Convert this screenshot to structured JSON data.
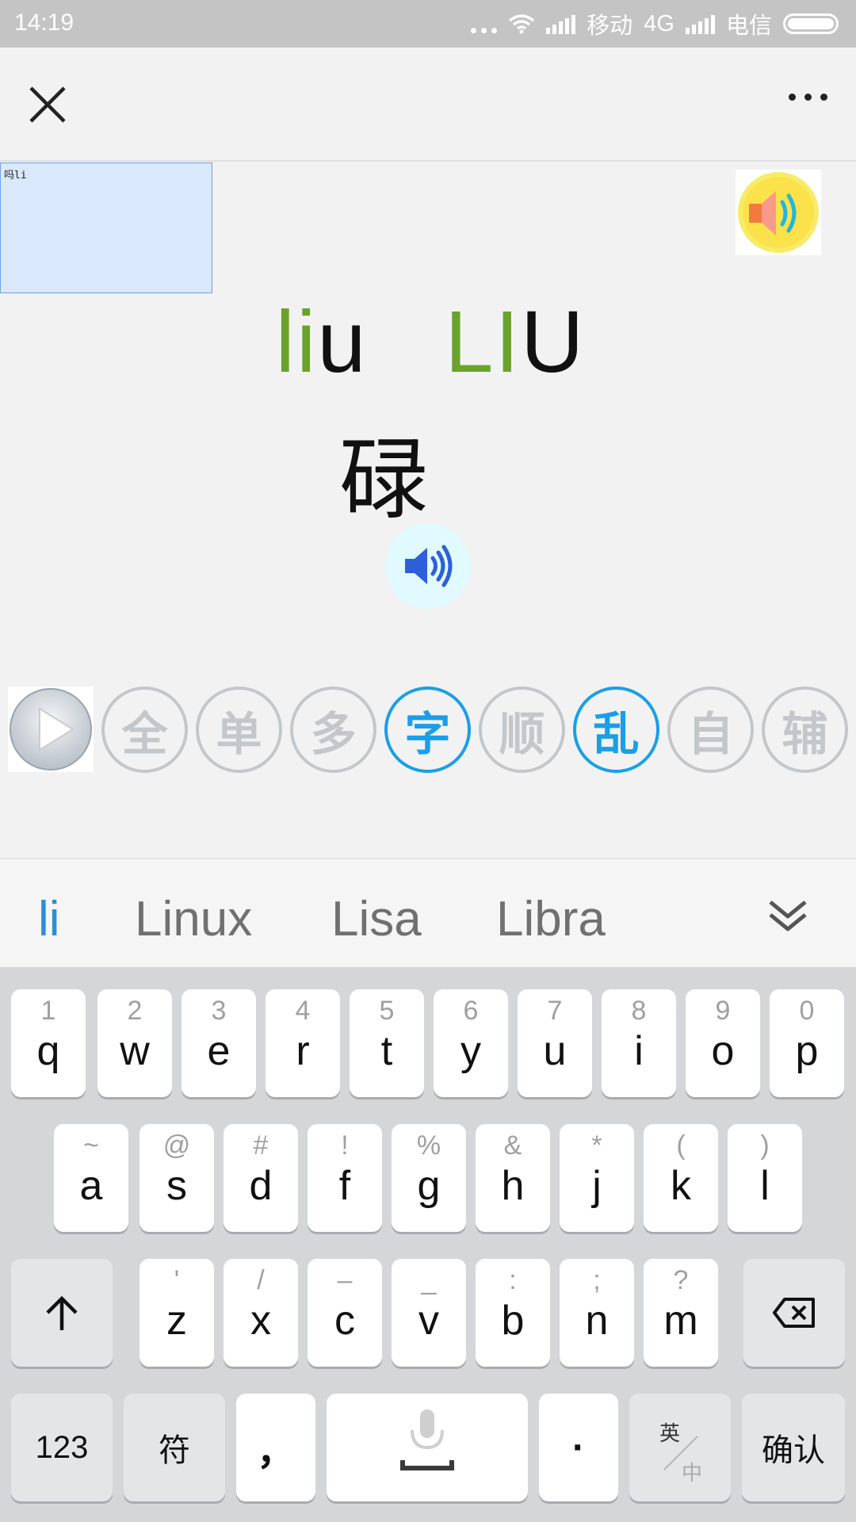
{
  "status_bar": {
    "time": "14:19",
    "carrier1": "移动",
    "network": "4G",
    "carrier2": "电信"
  },
  "header": {
    "close_icon": "close-icon",
    "more_icon": "more-icon"
  },
  "note_text": "吗li",
  "pinyin": {
    "lower_green": "li",
    "lower_black": "u",
    "upper_green": "LI",
    "upper_black": "U"
  },
  "character": "碌",
  "modes": [
    {
      "label": "全",
      "active": false
    },
    {
      "label": "单",
      "active": false
    },
    {
      "label": "多",
      "active": false
    },
    {
      "label": "字",
      "active": true
    },
    {
      "label": "顺",
      "active": false
    },
    {
      "label": "乱",
      "active": true
    },
    {
      "label": "自",
      "active": false
    },
    {
      "label": "辅",
      "active": false
    }
  ],
  "suggestions": [
    "li",
    "Linux",
    "Lisa",
    "Libra"
  ],
  "keyboard": {
    "row1": [
      {
        "sub": "1",
        "main": "q"
      },
      {
        "sub": "2",
        "main": "w"
      },
      {
        "sub": "3",
        "main": "e"
      },
      {
        "sub": "4",
        "main": "r"
      },
      {
        "sub": "5",
        "main": "t"
      },
      {
        "sub": "6",
        "main": "y"
      },
      {
        "sub": "7",
        "main": "u"
      },
      {
        "sub": "8",
        "main": "i"
      },
      {
        "sub": "9",
        "main": "o"
      },
      {
        "sub": "0",
        "main": "p"
      }
    ],
    "row2": [
      {
        "sub": "~",
        "main": "a"
      },
      {
        "sub": "@",
        "main": "s"
      },
      {
        "sub": "#",
        "main": "d"
      },
      {
        "sub": "!",
        "main": "f"
      },
      {
        "sub": "%",
        "main": "g"
      },
      {
        "sub": "&",
        "main": "h"
      },
      {
        "sub": "*",
        "main": "j"
      },
      {
        "sub": "(",
        "main": "k"
      },
      {
        "sub": ")",
        "main": "l"
      }
    ],
    "row3": [
      {
        "sub": "'",
        "main": "z"
      },
      {
        "sub": "/",
        "main": "x"
      },
      {
        "sub": "–",
        "main": "c"
      },
      {
        "sub": "_",
        "main": "v"
      },
      {
        "sub": ":",
        "main": "b"
      },
      {
        "sub": ";",
        "main": "n"
      },
      {
        "sub": "?",
        "main": "m"
      }
    ],
    "num_label": "123",
    "symbol_label": "符",
    "comma_label": "，",
    "period_label": "·",
    "lang_top": "英",
    "lang_bottom": "中",
    "confirm_label": "确认"
  },
  "colors": {
    "pinyin_green": "#6aa22c",
    "mode_active": "#1a9ee8",
    "mode_inactive": "#c4c7ca",
    "suggestion_active": "#2b8fd6"
  }
}
